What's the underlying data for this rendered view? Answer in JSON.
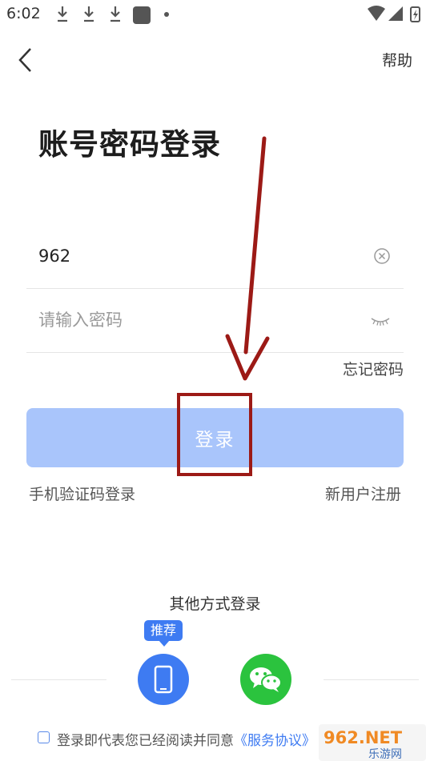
{
  "status_bar": {
    "time": "6:02"
  },
  "header": {
    "help_label": "帮助"
  },
  "page": {
    "title": "账号密码登录"
  },
  "form": {
    "account_value": "962",
    "password_placeholder": "请输入密码",
    "forgot_label": "忘记密码"
  },
  "login_button": {
    "label": "登录"
  },
  "links": {
    "sms_login": "手机验证码登录",
    "register": "新用户注册"
  },
  "other_login": {
    "title": "其他方式登录",
    "recommend_badge": "推荐"
  },
  "agreement": {
    "text": "登录即代表您已经阅读并同意",
    "link": "《服务协议》"
  },
  "watermark": {
    "main": "962.NET",
    "sub": "乐游网"
  },
  "colors": {
    "primary": "#3e7bf2",
    "login_disabled": "#a9c5fb",
    "wechat": "#2bc33e",
    "annotation": "#9c1a16"
  },
  "icons": [
    "download-icon",
    "notification-square-icon",
    "wifi-icon",
    "signal-icon",
    "battery-icon",
    "back-arrow-icon",
    "clear-icon",
    "eye-closed-icon",
    "phone-icon",
    "wechat-icon"
  ]
}
